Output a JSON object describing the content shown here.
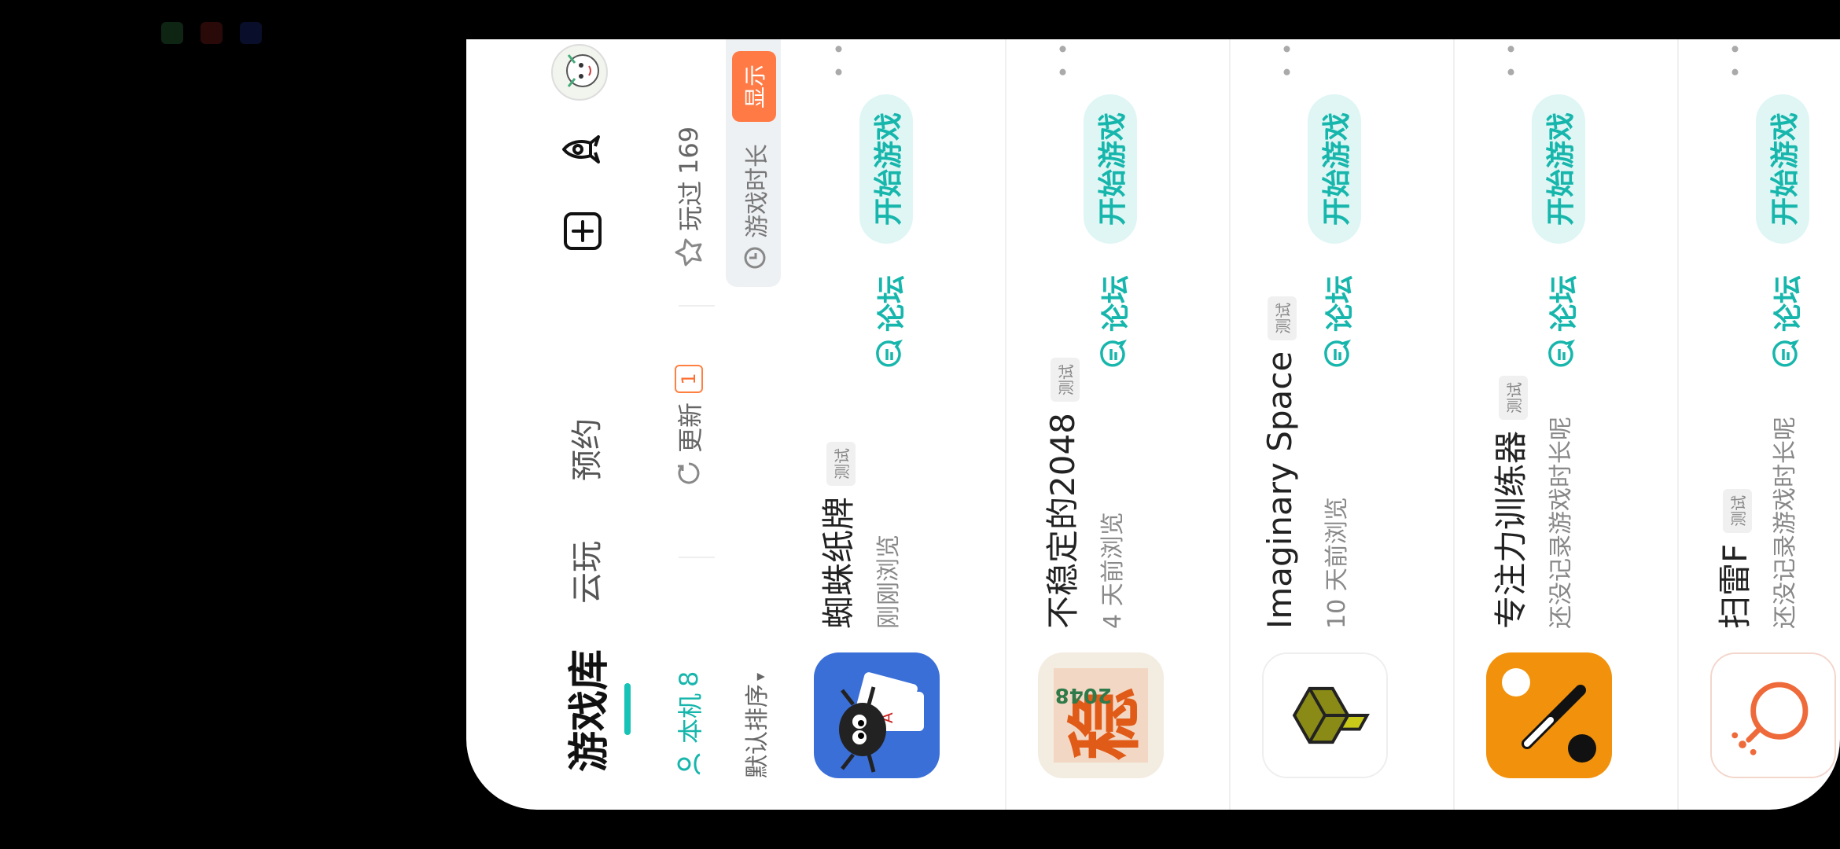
{
  "header": {
    "main_tab": "游戏库",
    "tab_cloud": "云玩",
    "tab_reserve": "预约"
  },
  "filters": {
    "local_label": "本机",
    "local_count": "8",
    "update_label": "更新",
    "update_count": "1",
    "played_label": "玩过",
    "played_count": "169"
  },
  "sort": {
    "label": "默认排序"
  },
  "playtime": {
    "label": "游戏时长",
    "button": "显示"
  },
  "games": [
    {
      "title": "蜘蛛纸牌",
      "tag": "测试",
      "subtitle": "刚刚浏览",
      "forum": "论坛",
      "play": "开始游戏"
    },
    {
      "title": "不稳定的2048",
      "tag": "测试",
      "subtitle": "4 天前浏览",
      "forum": "论坛",
      "play": "开始游戏"
    },
    {
      "title": "Imaginary Space",
      "tag": "测试",
      "subtitle": "10 天前浏览",
      "forum": "论坛",
      "play": "开始游戏"
    },
    {
      "title": "专注力训练器",
      "tag": "测试",
      "subtitle": "还没记录游戏时长呢",
      "forum": "论坛",
      "play": "开始游戏"
    },
    {
      "title": "扫雷F",
      "tag": "测试",
      "subtitle": "还没记录游戏时长呢",
      "forum": "论坛",
      "play": "开始游戏"
    }
  ],
  "icons": {
    "add": "plus-square-icon",
    "rocket": "rocket-icon",
    "avatar": "avatar",
    "forum": "chat-bubble-icon",
    "refresh": "refresh-icon",
    "star": "star-icon",
    "clock": "clock-icon",
    "local": "person-icon"
  },
  "colors": {
    "accent": "#17b6ac",
    "accent_light": "#dff6f4",
    "orange": "#ff7a45"
  }
}
